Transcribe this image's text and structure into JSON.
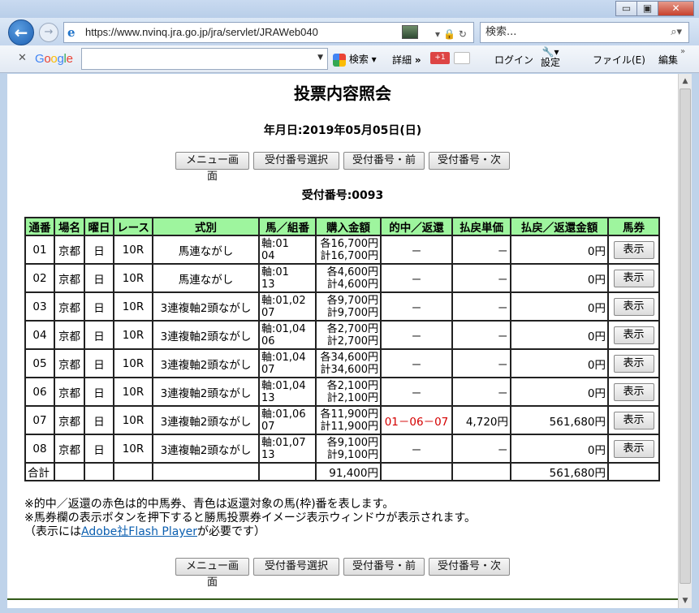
{
  "browser": {
    "address": "https://www.nvinq.jra.go.jp/jra/servlet/JRAWeb040",
    "search_placeholder": "検索...",
    "window_buttons": {
      "minimize": "▭",
      "maximize": "▣",
      "close": "✕"
    },
    "toolbar": {
      "google": "Google",
      "search_label": "検索",
      "detail_label": "詳細",
      "more": "»",
      "gplus": "+1",
      "login_label": "ログイン",
      "settings_label": "設定",
      "file_label": "ファイル(E)",
      "edit_label": "編集"
    }
  },
  "page": {
    "title": "投票内容照会",
    "date": "年月日:2019年05月05日(日)",
    "receipt": "受付番号:0093",
    "nav_buttons": [
      "メニュー画面",
      "受付番号選択",
      "受付番号・前",
      "受付番号・次"
    ]
  },
  "table": {
    "headers": [
      "通番",
      "場名",
      "曜日",
      "レース",
      "式別",
      "馬／組番",
      "購入金額",
      "的中／返還",
      "払戻単価",
      "払戻／返還金額",
      "馬券"
    ],
    "rows": [
      {
        "no": "01",
        "venue": "京都",
        "day": "日",
        "race": "10R",
        "type": "馬連ながし",
        "kumi1": "軸:01",
        "kumi2": "04",
        "amt1": "各16,700円",
        "amt2": "計16,700円",
        "hit": "－",
        "unit": "－",
        "payout": "0円",
        "btn": "表示",
        "is_hit": false
      },
      {
        "no": "02",
        "venue": "京都",
        "day": "日",
        "race": "10R",
        "type": "馬連ながし",
        "kumi1": "軸:01",
        "kumi2": "13",
        "amt1": "各4,600円",
        "amt2": "計4,600円",
        "hit": "－",
        "unit": "－",
        "payout": "0円",
        "btn": "表示",
        "is_hit": false
      },
      {
        "no": "03",
        "venue": "京都",
        "day": "日",
        "race": "10R",
        "type": "3連複軸2頭ながし",
        "kumi1": "軸:01,02",
        "kumi2": "07",
        "amt1": "各9,700円",
        "amt2": "計9,700円",
        "hit": "－",
        "unit": "－",
        "payout": "0円",
        "btn": "表示",
        "is_hit": false
      },
      {
        "no": "04",
        "venue": "京都",
        "day": "日",
        "race": "10R",
        "type": "3連複軸2頭ながし",
        "kumi1": "軸:01,04",
        "kumi2": "06",
        "amt1": "各2,700円",
        "amt2": "計2,700円",
        "hit": "－",
        "unit": "－",
        "payout": "0円",
        "btn": "表示",
        "is_hit": false
      },
      {
        "no": "05",
        "venue": "京都",
        "day": "日",
        "race": "10R",
        "type": "3連複軸2頭ながし",
        "kumi1": "軸:01,04",
        "kumi2": "07",
        "amt1": "各34,600円",
        "amt2": "計34,600円",
        "hit": "－",
        "unit": "－",
        "payout": "0円",
        "btn": "表示",
        "is_hit": false
      },
      {
        "no": "06",
        "venue": "京都",
        "day": "日",
        "race": "10R",
        "type": "3連複軸2頭ながし",
        "kumi1": "軸:01,04",
        "kumi2": "13",
        "amt1": "各2,100円",
        "amt2": "計2,100円",
        "hit": "－",
        "unit": "－",
        "payout": "0円",
        "btn": "表示",
        "is_hit": false
      },
      {
        "no": "07",
        "venue": "京都",
        "day": "日",
        "race": "10R",
        "type": "3連複軸2頭ながし",
        "kumi1": "軸:01,06",
        "kumi2": "07",
        "amt1": "各11,900円",
        "amt2": "計11,900円",
        "hit": "01－06－07",
        "unit": "4,720円",
        "payout": "561,680円",
        "btn": "表示",
        "is_hit": true
      },
      {
        "no": "08",
        "venue": "京都",
        "day": "日",
        "race": "10R",
        "type": "3連複軸2頭ながし",
        "kumi1": "軸:01,07",
        "kumi2": "13",
        "amt1": "各9,100円",
        "amt2": "計9,100円",
        "hit": "－",
        "unit": "－",
        "payout": "0円",
        "btn": "表示",
        "is_hit": false
      }
    ],
    "total": {
      "label": "合計",
      "purchase": "91,400円",
      "payout": "561,680円"
    }
  },
  "notes": {
    "line1": "※的中／返還の赤色は的中馬券、青色は返還対象の馬(枠)番を表します。",
    "line2": "※馬券欄の表示ボタンを押下すると勝馬投票券イメージ表示ウィンドウが表示されます。",
    "line3_pre": "（表示には",
    "line3_link": "Adobe社Flash Player",
    "line3_post": "が必要です）"
  },
  "colors": {
    "header_bg": "#9ef59e",
    "hit_text": "#d40000",
    "link": "#0b5fb0"
  }
}
